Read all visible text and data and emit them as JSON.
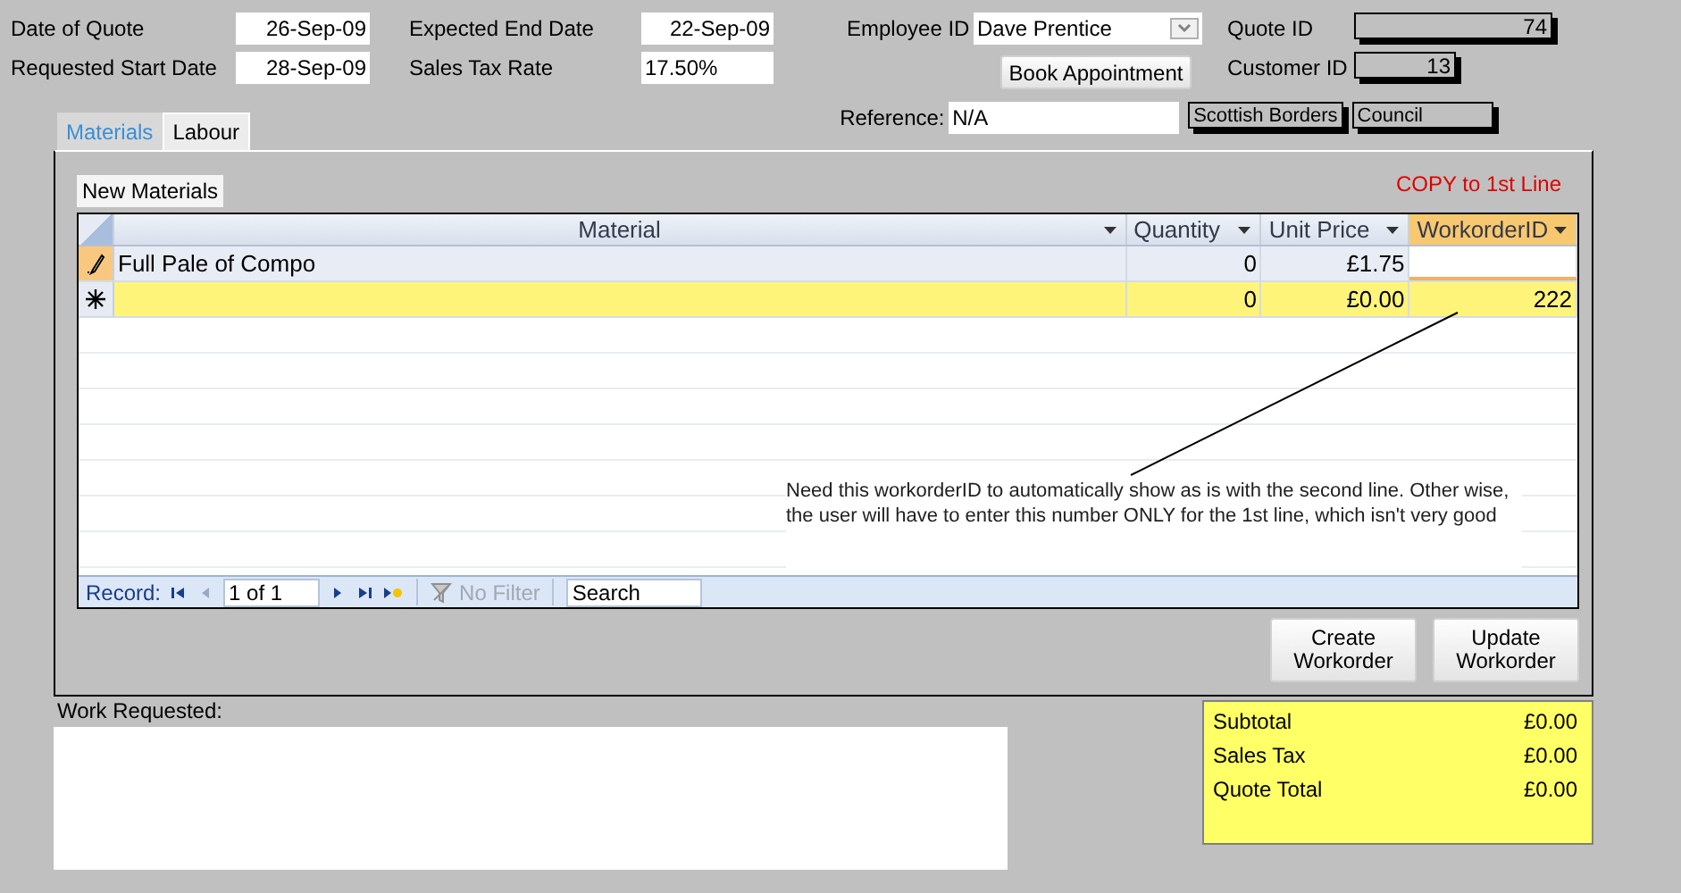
{
  "fields": [
    {
      "label": "Date of Quote",
      "value": "26-Sep-09"
    },
    {
      "label": "Expected End Date",
      "value": "22-Sep-09"
    },
    {
      "label": "Requested Start Date",
      "value": "28-Sep-09"
    },
    {
      "label": "Sales Tax Rate",
      "value": "17.50%"
    }
  ],
  "employee": {
    "label": "Employee ID",
    "value": "Dave Prentice"
  },
  "book_appointment_button": "Book Appointment",
  "quote_id": {
    "label": "Quote ID",
    "value": "74"
  },
  "customer_id": {
    "label": "Customer ID",
    "value": "13"
  },
  "reference": {
    "label": "Reference:",
    "value": "N/A"
  },
  "customer_name": [
    "Scottish Borders",
    "Council"
  ],
  "tabs": [
    {
      "label": "Materials",
      "selected": true
    },
    {
      "label": "Labour",
      "selected": false
    }
  ],
  "new_materials_button": "New Materials",
  "copy_link": "COPY to 1st Line",
  "table": {
    "columns": [
      {
        "label": "Material",
        "selected": false
      },
      {
        "label": "Quantity",
        "selected": false
      },
      {
        "label": "Unit Price",
        "selected": false
      },
      {
        "label": "WorkorderID",
        "selected": true
      }
    ],
    "rows": [
      {
        "kind": "editing",
        "selected": false,
        "cells": [
          "Full Pale of Compo",
          "0",
          "£1.75",
          ""
        ]
      },
      {
        "kind": "new",
        "selected": true,
        "cells": [
          "",
          "0",
          "£0.00",
          "222"
        ]
      }
    ]
  },
  "note": "Need this workorderID to automatically show as is with the second line. Other wise, the user will have to enter this number ONLY for the 1st line, which isn't very good",
  "navigation": {
    "label": "Record:",
    "position": "1 of 1",
    "filter": "No Filter",
    "search_placeholder": "Search"
  },
  "buttons": [
    "Create Workorder",
    "Update Workorder"
  ],
  "work_requested": {
    "label": "Work Requested:"
  },
  "totals": [
    {
      "label": "Subtotal",
      "value": "£0.00"
    },
    {
      "label": "Sales Tax",
      "value": "£0.00"
    },
    {
      "label": "Quote Total",
      "value": "£0.00"
    }
  ]
}
